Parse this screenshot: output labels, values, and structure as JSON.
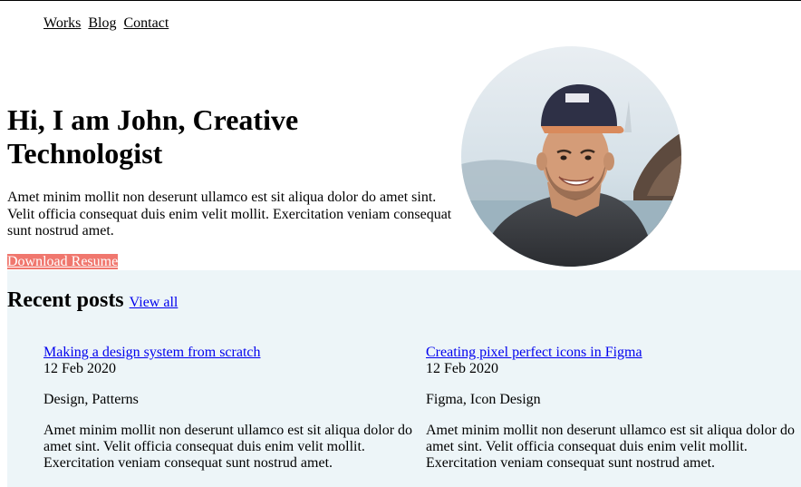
{
  "nav": {
    "items": [
      "Works",
      "Blog",
      "Contact"
    ]
  },
  "hero": {
    "title": "Hi, I am John, Creative Technologist",
    "text": "Amet minim mollit non deserunt ullamco est sit aliqua dolor do amet sint. Velit officia consequat duis enim velit mollit. Exercitation veniam consequat sunt nostrud amet.",
    "button_label": "Download Resume"
  },
  "posts": {
    "heading": "Recent posts",
    "view_all_label": "View all",
    "items": [
      {
        "title": "Making a design system from scratch",
        "date": "12 Feb 2020",
        "tags": "Design, Patterns",
        "excerpt": "Amet minim mollit non deserunt ullamco est sit aliqua dolor do amet sint. Velit officia consequat duis enim velit mollit. Exercitation veniam consequat sunt nostrud amet."
      },
      {
        "title": "Creating pixel perfect icons in Figma",
        "date": "12 Feb 2020",
        "tags": "Figma, Icon Design",
        "excerpt": "Amet minim mollit non deserunt ullamco est sit aliqua dolor do amet sint. Velit officia consequat duis enim velit mollit. Exercitation veniam consequat sunt nostrud amet."
      }
    ]
  },
  "colors": {
    "button_bg": "#f0776e",
    "posts_bg": "#edf5f8",
    "link": "#0000ee"
  }
}
